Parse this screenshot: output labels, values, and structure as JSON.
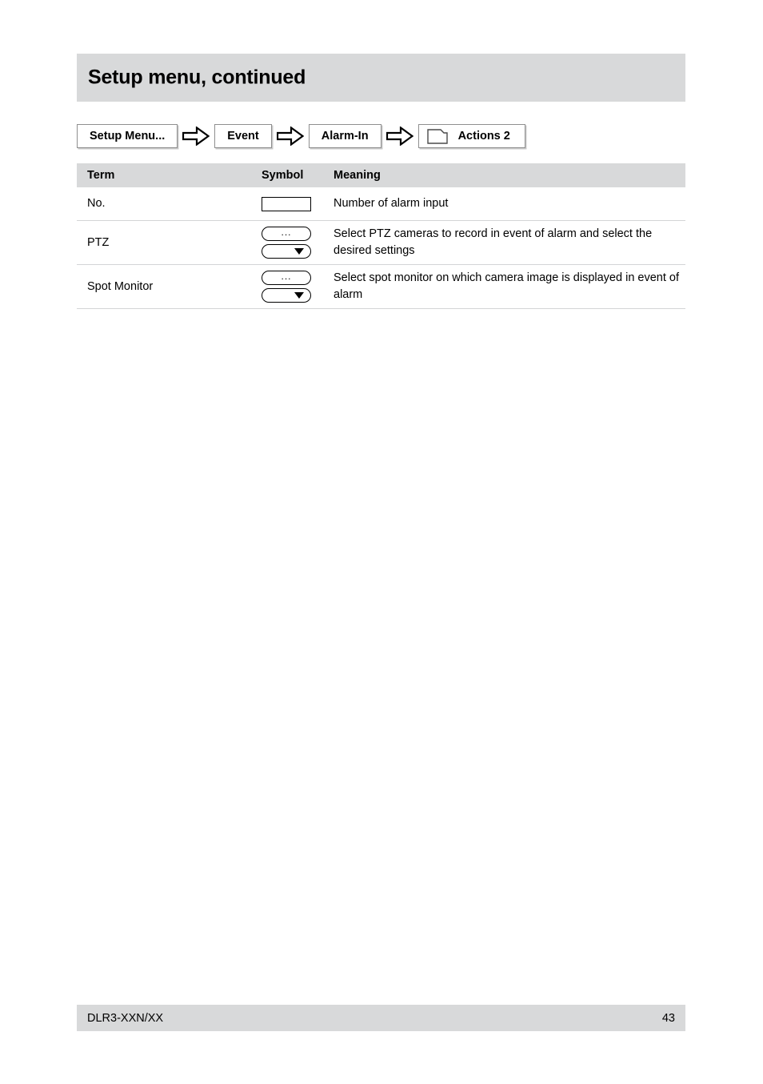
{
  "header": {
    "title": "Setup menu, continued"
  },
  "breadcrumb": {
    "items": [
      {
        "label": "Setup Menu...",
        "icon": null
      },
      {
        "label": "Event",
        "icon": null
      },
      {
        "label": "Alarm-In",
        "icon": null
      },
      {
        "label": "Actions 2",
        "icon": "tab-folder-icon"
      }
    ],
    "separator_icon": "block-arrow-right-icon"
  },
  "table": {
    "columns": [
      "Term",
      "Symbol",
      "Meaning"
    ],
    "rows": [
      {
        "term": "No.",
        "symbols": [
          "text-field"
        ],
        "meaning": "Number of alarm input"
      },
      {
        "term": "PTZ",
        "symbols": [
          "ellipsis-button",
          "dropdown-select"
        ],
        "symbol_label": "...",
        "meaning": "Select PTZ cameras to record in event of alarm and select the desired settings"
      },
      {
        "term": "Spot Monitor",
        "symbols": [
          "ellipsis-button",
          "dropdown-select"
        ],
        "symbol_label": "...",
        "meaning": "Select spot monitor on which camera image is displayed in event of alarm"
      }
    ]
  },
  "footer": {
    "document_id": "DLR3-XXN/XX",
    "page_number": "43"
  },
  "colors": {
    "band_gray": "#d8d9da",
    "rule_gray": "#d3d4d6",
    "text": "#000000"
  }
}
